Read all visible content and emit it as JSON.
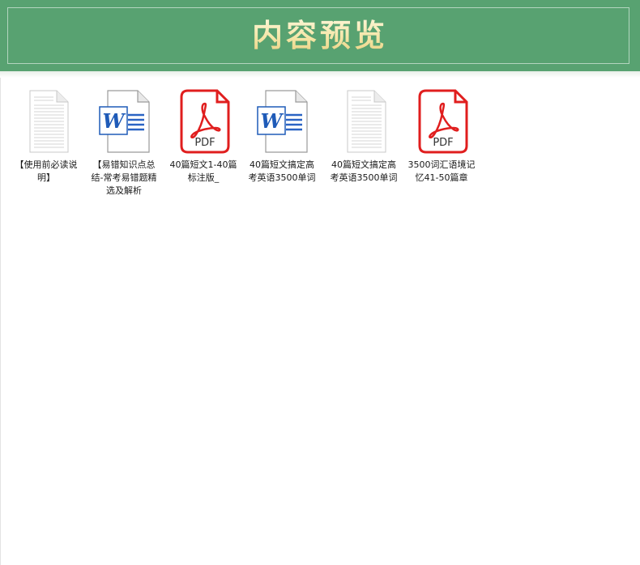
{
  "banner": {
    "title": "内容预览"
  },
  "colors": {
    "banner": "#58a271",
    "pdf": "#e01e1e",
    "word": "#1f5bb8"
  },
  "files": [
    {
      "name": "【使用前必读说明】",
      "type": "txt",
      "icon": "text-document-icon"
    },
    {
      "name": "【易错知识点总结-常考易错题精选及解析",
      "type": "word",
      "icon": "word-document-icon",
      "badge": "W"
    },
    {
      "name": "40篇短文1-40篇标注版_",
      "type": "pdf",
      "icon": "pdf-document-icon",
      "badge": "PDF"
    },
    {
      "name": "40篇短文搞定高考英语3500单词",
      "type": "word",
      "icon": "word-document-icon",
      "badge": "W"
    },
    {
      "name": "40篇短文搞定高考英语3500单词",
      "type": "txt",
      "icon": "text-document-icon"
    },
    {
      "name": "3500词汇语境记忆41-50篇章",
      "type": "pdf",
      "icon": "pdf-document-icon",
      "badge": "PDF"
    }
  ]
}
